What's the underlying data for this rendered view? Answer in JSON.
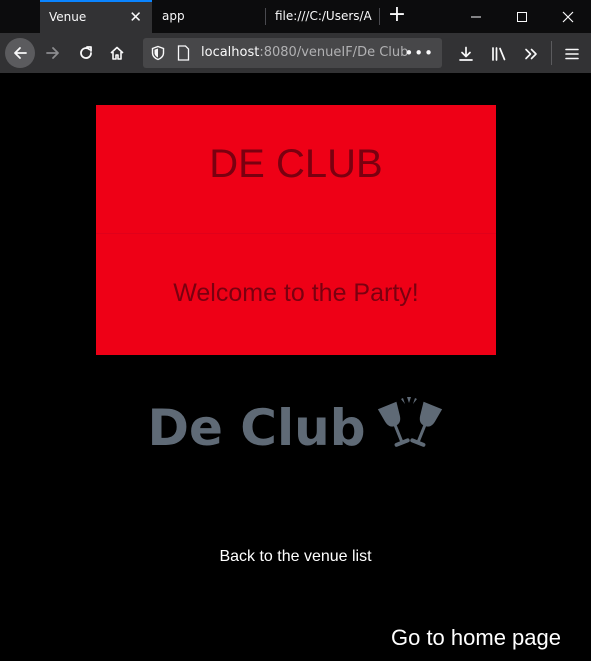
{
  "browser": {
    "tabs": [
      {
        "title": "Venue",
        "active": true
      },
      {
        "title": "app",
        "active": false
      },
      {
        "title": "file:///C:/Users/A",
        "active": false
      }
    ],
    "tab_close_glyph": "✕",
    "new_tab_glyph": "+",
    "window": {
      "minimize": "—",
      "maximize": "☐",
      "close": "✕"
    },
    "url_host": "localhost",
    "url_path": ":8080/venueIF/De Club",
    "url_more": "•••",
    "icons": [
      "back-arrow-icon",
      "forward-arrow-icon",
      "reload-icon",
      "home-icon",
      "shield-icon",
      "page-icon",
      "download-icon",
      "library-icon",
      "overflow-chevron-icon",
      "menu-icon"
    ]
  },
  "page": {
    "hero_title": "DE CLUB",
    "hero_subtitle": "Welcome to the Party!",
    "venue_name": "De Club",
    "venue_icon": "clinking-glasses-icon",
    "back_link": "Back to the venue list",
    "home_link": "Go to home page"
  },
  "colors": {
    "hero_background": "#ee0016",
    "hero_text": "#7a0010",
    "venue_name": "#5f6a76",
    "page_background": "#000000",
    "active_tab_accent": "#0a84ff"
  }
}
